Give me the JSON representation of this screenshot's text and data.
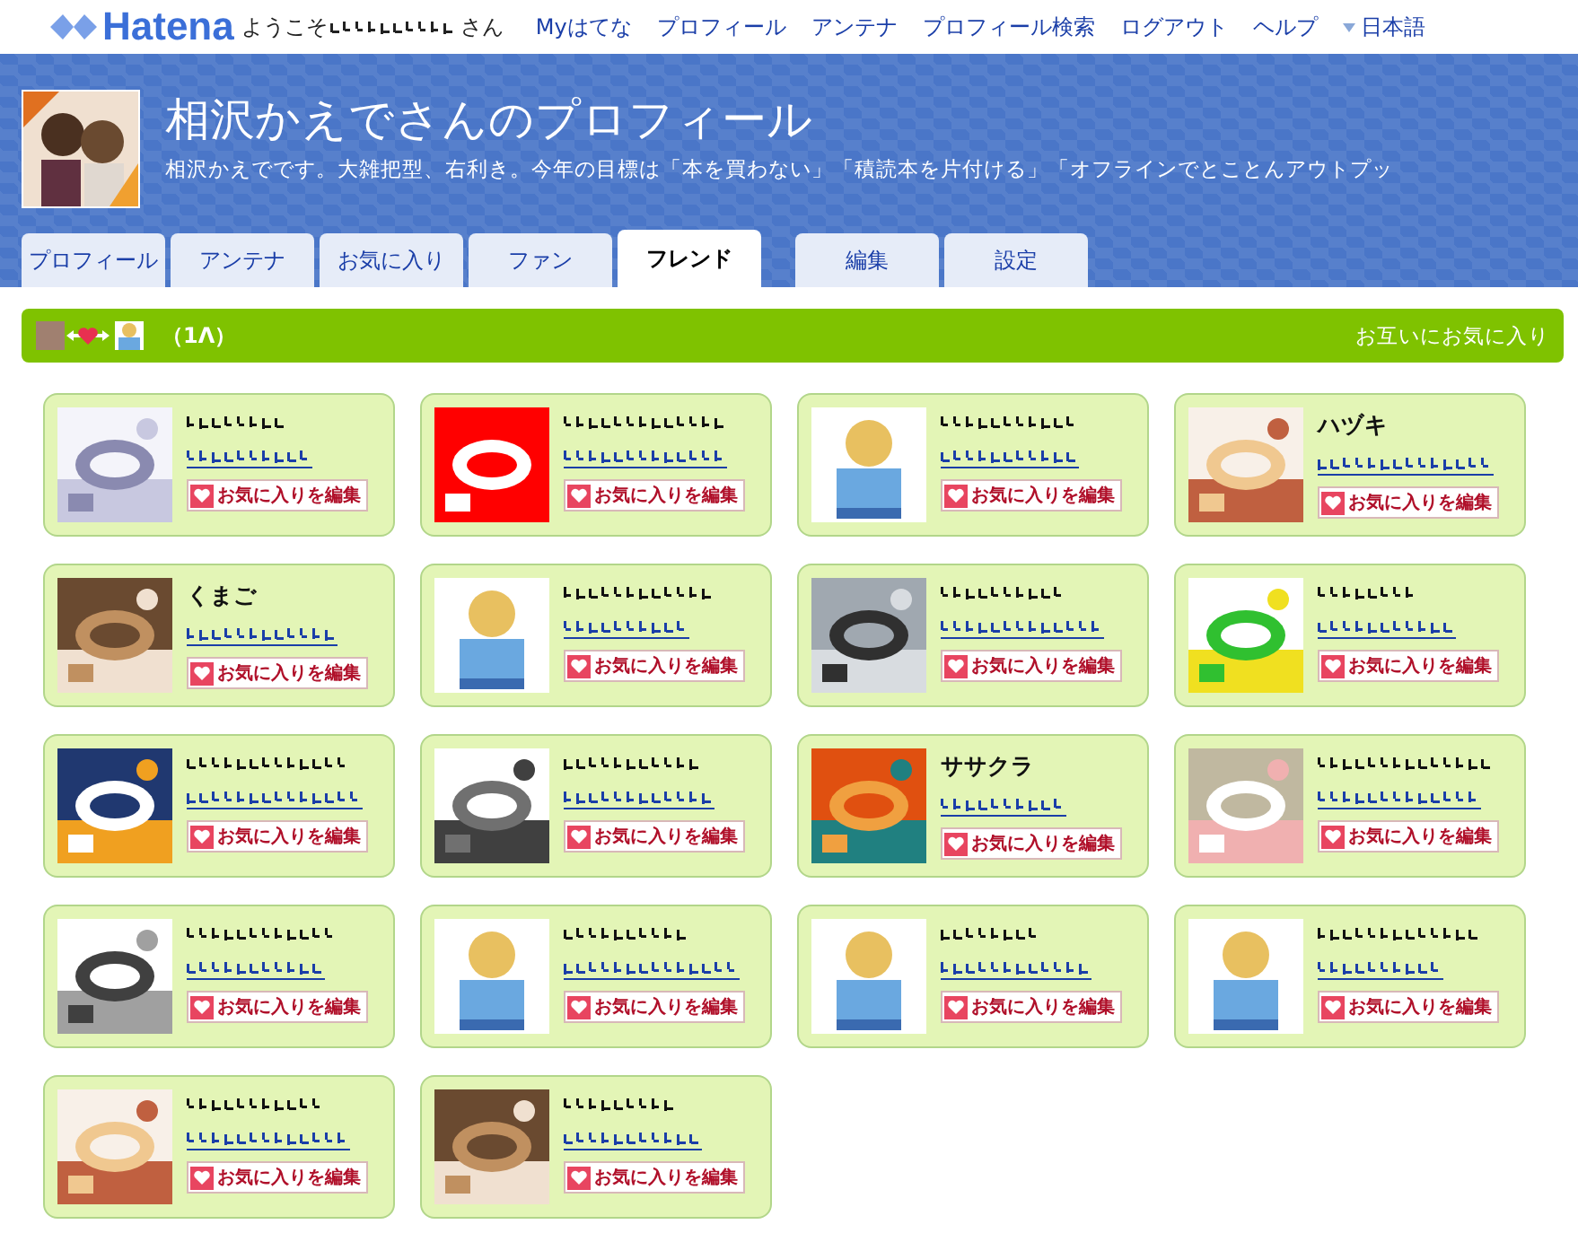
{
  "topbar": {
    "logo": "Hatena",
    "welcome_prefix": "ようこそ",
    "welcome_suffix": "さん",
    "links": [
      "Myはてな",
      "プロフィール",
      "アンテナ",
      "プロフィール検索",
      "ログアウト",
      "ヘルプ"
    ],
    "language": "日本語"
  },
  "profile": {
    "title": "相沢かえでさんのプロフィール",
    "description": "相沢かえでです。大雑把型、右利き。今年の目標は「本を買わない」「積読本を片付ける」「オフラインでとことんアウトプッ"
  },
  "tabs": [
    {
      "label": "プロフィール",
      "selected": false
    },
    {
      "label": "アンテナ",
      "selected": false
    },
    {
      "label": "お気に入り",
      "selected": false
    },
    {
      "label": "ファン",
      "selected": false
    },
    {
      "label": "フレンド",
      "selected": true
    },
    {
      "label": "編集",
      "selected": false
    },
    {
      "label": "設定",
      "selected": false
    }
  ],
  "section": {
    "count": "（1Λ）",
    "caption": "お互いにお気に入り"
  },
  "friends": [
    {
      "kind": "obfuscated",
      "button": "お気に入りを編集"
    },
    {
      "kind": "obfuscated",
      "button": "お気に入りを編集"
    },
    {
      "kind": "obfuscated",
      "avatar": {
        "kind": "default"
      },
      "button": "お気に入りを編集"
    },
    {
      "kind": "text",
      "name": "ハヅキ",
      "button": "お気に入りを編集"
    },
    {
      "kind": "text",
      "name": "くまご",
      "button": "お気に入りを編集"
    },
    {
      "kind": "obfuscated",
      "avatar": {
        "kind": "default"
      },
      "button": "お気に入りを編集"
    },
    {
      "kind": "obfuscated",
      "button": "お気に入りを編集"
    },
    {
      "kind": "obfuscated",
      "button": "お気に入りを編集"
    },
    {
      "kind": "obfuscated",
      "button": "お気に入りを編集"
    },
    {
      "kind": "obfuscated",
      "button": "お気に入りを編集"
    },
    {
      "kind": "text",
      "name": "ササクラ",
      "button": "お気に入りを編集"
    },
    {
      "kind": "obfuscated",
      "button": "お気に入りを編集"
    },
    {
      "kind": "obfuscated",
      "button": "お気に入りを編集"
    },
    {
      "kind": "obfuscated",
      "avatar": {
        "kind": "default"
      },
      "button": "お気に入りを編集"
    },
    {
      "kind": "obfuscated",
      "avatar": {
        "kind": "default"
      },
      "button": "お気に入りを編集"
    },
    {
      "kind": "obfuscated",
      "avatar": {
        "kind": "default"
      },
      "button": "お気に入りを編集"
    },
    {
      "kind": "obfuscated",
      "button": "お気に入りを編集"
    },
    {
      "kind": "obfuscated",
      "button": "お気に入りを編集"
    }
  ]
}
